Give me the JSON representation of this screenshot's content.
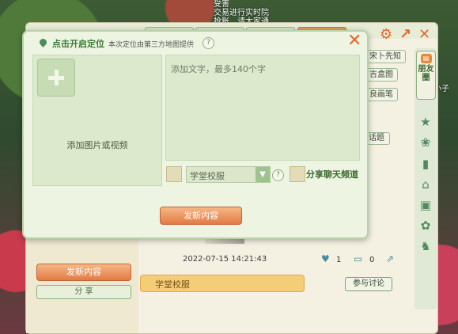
{
  "background": {
    "overlay_lines": [
      "受害",
      "交易进行实时院",
      "抢账…请大家通"
    ],
    "overlay_right": "小子"
  },
  "back_panel": {
    "side_items": [
      "宋卜先知",
      "吉盒图",
      "良画笔"
    ],
    "topic_chip": "话题",
    "rightbar": {
      "friends_tab": "朋友圈",
      "icons": [
        "star-icon",
        "paw-icon",
        "bar-chart-icon",
        "home-icon",
        "box-icon",
        "palette-icon",
        "shirt-icon"
      ]
    },
    "post": {
      "date": "2022-07-15 14:21:43",
      "likes": "1",
      "comments": "0",
      "tag": "学堂校服",
      "discuss_label": "参与讨论"
    },
    "left_buttons": {
      "publish": "发新内容",
      "share": "分 享"
    }
  },
  "dialog": {
    "location_label": "点击开启定位",
    "location_note": "本次定位由第三方地图提供",
    "help_symbol": "?",
    "media_label": "添加图片或视频",
    "text_placeholder": "添加文字，最多140个字",
    "select_value": "学堂校服",
    "share_channel_label": "分享聊天频道",
    "publish_label": "发新内容"
  },
  "colors": {
    "accent_orange": "#e27b45",
    "panel_green": "#eef4e2",
    "tag_yellow": "#f4ce76"
  }
}
